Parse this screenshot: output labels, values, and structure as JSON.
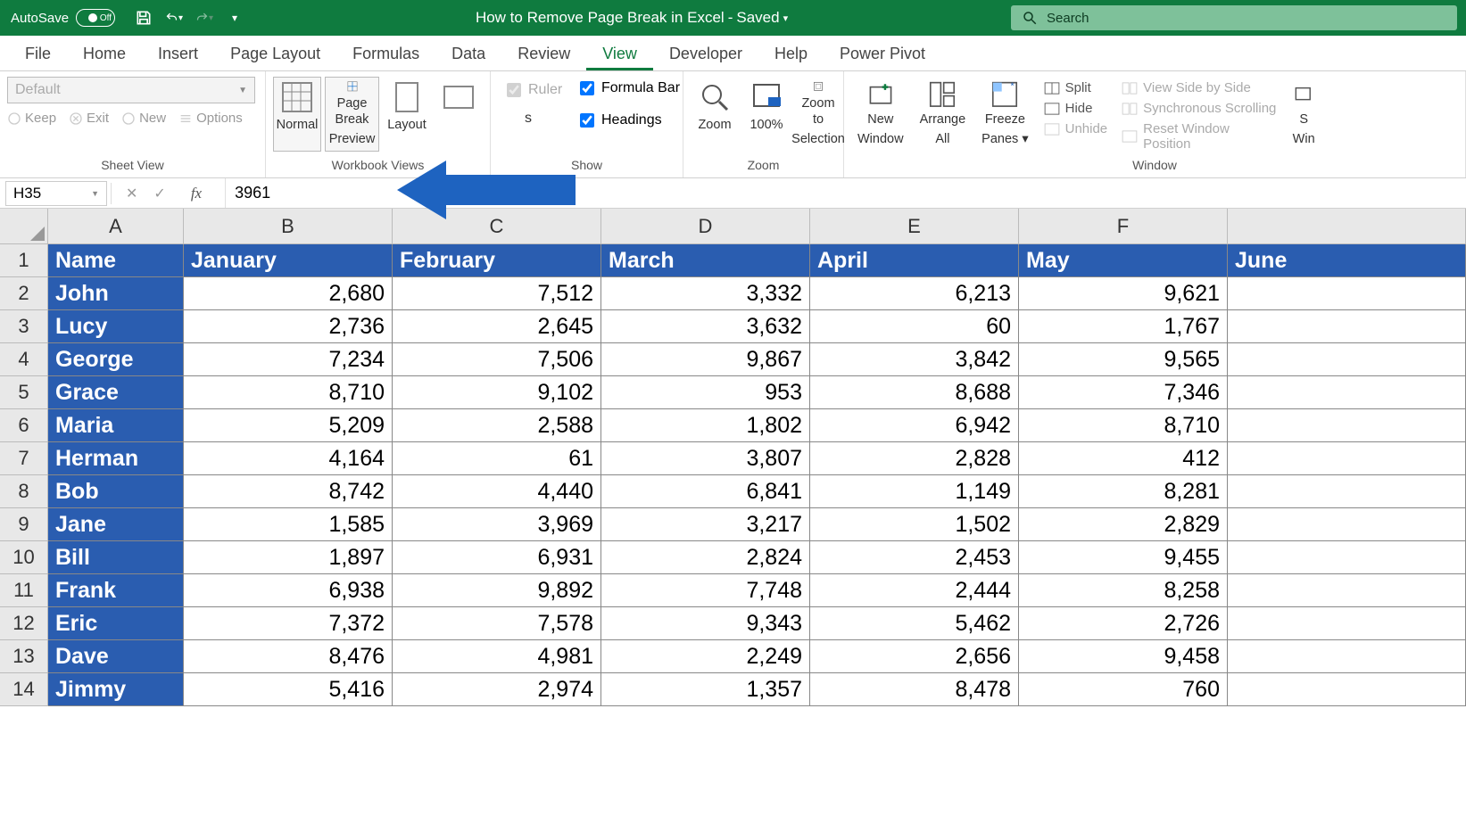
{
  "titlebar": {
    "autosave_label": "AutoSave",
    "autosave_state": "Off",
    "doc_title": "How to Remove Page Break in Excel",
    "saved_state": "Saved",
    "search_placeholder": "Search"
  },
  "tabs": [
    "File",
    "Home",
    "Insert",
    "Page Layout",
    "Formulas",
    "Data",
    "Review",
    "View",
    "Developer",
    "Help",
    "Power Pivot"
  ],
  "active_tab_index": 7,
  "ribbon": {
    "sheet_view": {
      "combo": "Default",
      "keep": "Keep",
      "exit": "Exit",
      "new": "New",
      "options": "Options",
      "label": "Sheet View"
    },
    "workbook_views": {
      "normal": "Normal",
      "pbp_line1": "Page Break",
      "pbp_line2": "Preview",
      "layout": "Layout",
      "label": "Workbook Views"
    },
    "show": {
      "ruler": "Ruler",
      "formula_bar": "Formula Bar",
      "headings": "Headings",
      "s_suffix": "s",
      "label": "Show"
    },
    "zoom": {
      "zoom": "Zoom",
      "hundred": "100%",
      "to_sel_1": "Zoom to",
      "to_sel_2": "Selection",
      "label": "Zoom"
    },
    "window": {
      "new_1": "New",
      "new_2": "Window",
      "arr_1": "Arrange",
      "arr_2": "All",
      "frz_1": "Freeze",
      "frz_2": "Panes",
      "split": "Split",
      "hide": "Hide",
      "unhide": "Unhide",
      "vsbs": "View Side by Side",
      "sync": "Synchronous Scrolling",
      "reset": "Reset Window Position",
      "sw": "S",
      "win": "Win",
      "label": "Window"
    }
  },
  "formula_bar": {
    "name_box": "H35",
    "value": "3961"
  },
  "columns": [
    "A",
    "B",
    "C",
    "D",
    "E",
    "F"
  ],
  "partial_col_G_header": "",
  "header_row": [
    "Name",
    "January",
    "February",
    "March",
    "April",
    "May",
    "June"
  ],
  "rows": [
    {
      "n": "John",
      "v": [
        "2,680",
        "7,512",
        "3,332",
        "6,213",
        "9,621"
      ]
    },
    {
      "n": "Lucy",
      "v": [
        "2,736",
        "2,645",
        "3,632",
        "60",
        "1,767"
      ]
    },
    {
      "n": "George",
      "v": [
        "7,234",
        "7,506",
        "9,867",
        "3,842",
        "9,565"
      ]
    },
    {
      "n": "Grace",
      "v": [
        "8,710",
        "9,102",
        "953",
        "8,688",
        "7,346"
      ]
    },
    {
      "n": "Maria",
      "v": [
        "5,209",
        "2,588",
        "1,802",
        "6,942",
        "8,710"
      ]
    },
    {
      "n": "Herman",
      "v": [
        "4,164",
        "61",
        "3,807",
        "2,828",
        "412"
      ]
    },
    {
      "n": "Bob",
      "v": [
        "8,742",
        "4,440",
        "6,841",
        "1,149",
        "8,281"
      ]
    },
    {
      "n": "Jane",
      "v": [
        "1,585",
        "3,969",
        "3,217",
        "1,502",
        "2,829"
      ]
    },
    {
      "n": "Bill",
      "v": [
        "1,897",
        "6,931",
        "2,824",
        "2,453",
        "9,455"
      ]
    },
    {
      "n": "Frank",
      "v": [
        "6,938",
        "9,892",
        "7,748",
        "2,444",
        "8,258"
      ]
    },
    {
      "n": "Eric",
      "v": [
        "7,372",
        "7,578",
        "9,343",
        "5,462",
        "2,726"
      ]
    },
    {
      "n": "Dave",
      "v": [
        "8,476",
        "4,981",
        "2,249",
        "2,656",
        "9,458"
      ]
    },
    {
      "n": "Jimmy",
      "v": [
        "5,416",
        "2,974",
        "1,357",
        "8,478",
        "760"
      ]
    }
  ],
  "row_numbers": [
    "1",
    "2",
    "3",
    "4",
    "5",
    "6",
    "7",
    "8",
    "9",
    "10",
    "11",
    "12",
    "13",
    "14"
  ]
}
